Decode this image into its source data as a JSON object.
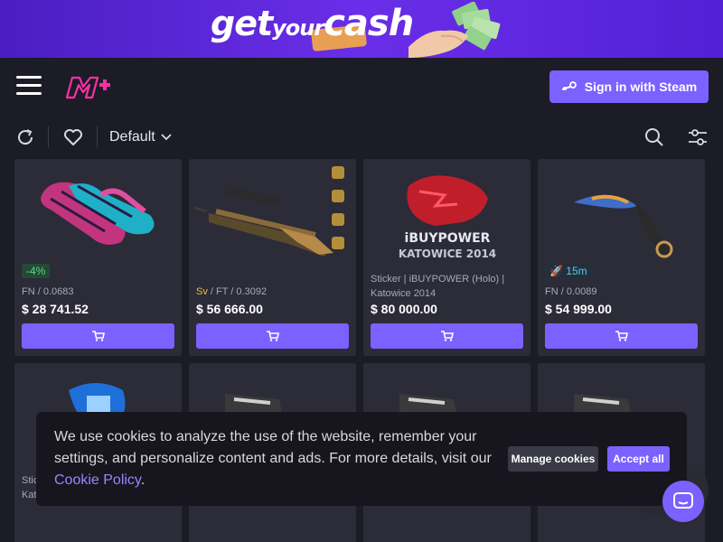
{
  "banner": {
    "word1": "get",
    "word2": "your",
    "word3": "cash",
    "colors": {
      "bg": "#5a26dc",
      "accent": "#ffb43a"
    }
  },
  "header": {
    "menu_icon": "hamburger-menu-icon",
    "logo_icon": "market-logo-icon",
    "signin_label": "Sign in with Steam",
    "signin_icon": "steam-icon"
  },
  "toolbar": {
    "refresh_icon": "refresh-icon",
    "favorites_icon": "heart-icon",
    "sort_label": "Default",
    "sort_icon": "chevron-down-icon",
    "search_icon": "search-icon",
    "filter_icon": "filter-sliders-icon"
  },
  "items": [
    {
      "image": "sport-gloves",
      "badge": "-4%",
      "badge_type": "discount",
      "tag": "",
      "meta": "FN / 0.0683",
      "name": "",
      "price": "$ 28 741.52"
    },
    {
      "image": "awp-rifle-with-stickers",
      "badge": "",
      "badge_type": "",
      "tag": "Sv",
      "meta": " / FT / 0.3092",
      "name": "",
      "price": "$ 56 666.00"
    },
    {
      "image": "ibuypower-sticker",
      "badge": "",
      "badge_type": "",
      "tag": "",
      "meta": "",
      "name": "Sticker | iBUYPOWER (Holo) | Katowice 2014",
      "price": "$ 80 000.00"
    },
    {
      "image": "karambit-knife",
      "badge": "15m",
      "badge_type": "fast",
      "tag": "",
      "meta": "FN / 0.0089",
      "name": "",
      "price": "$ 54 999.00"
    }
  ],
  "row2": [
    {
      "image": "sticker-blue",
      "name_partial": "Stic",
      "name_partial2": "Kat"
    },
    {
      "image": "awp-dark"
    },
    {
      "image": "awp-dark"
    },
    {
      "image": "awp-dark"
    }
  ],
  "sticker_preview_text": {
    "ibp": "iBUYPOWER",
    "kat": "KATOWICE 2014"
  },
  "cart_icon": "shopping-cart-icon",
  "cookie": {
    "text": "We use cookies to analyze the use of the website, remember your settings, and personalize content and ads. For more details, visit our ",
    "link": "Cookie Policy",
    "after": ".",
    "manage_label": "Manage cookies",
    "accept_label": "Accept all"
  },
  "chat_icon": "chat-widget-icon",
  "colors": {
    "page_bg": "#1c1c26",
    "card_bg": "#2c2b38",
    "accent": "#7b61ff",
    "discount": "#58d68a",
    "fast": "#5ec6e8",
    "souvenir": "#e8c04a"
  }
}
